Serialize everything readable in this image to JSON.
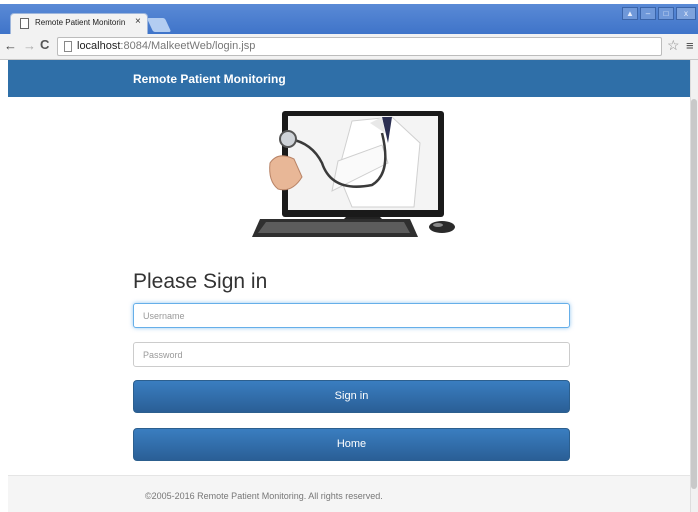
{
  "browser": {
    "tab_title": "Remote Patient Monitoring",
    "tab_close": "×",
    "url_host": "localhost",
    "url_path": ":8084/MalkeetWeb/login.jsp",
    "window_buttons": [
      "▲",
      "–",
      "□",
      "x"
    ],
    "nav_icons": {
      "back": "←",
      "forward": "→",
      "reload": "C",
      "star": "☆",
      "menu": "≡"
    }
  },
  "navbar": {
    "brand": "Remote Patient Monitoring"
  },
  "hero": {
    "image": "doctor-with-stethoscope-reaching-out-of-computer-monitor"
  },
  "form": {
    "heading": "Please Sign in",
    "username_placeholder": "Username",
    "username_value": "",
    "password_placeholder": "Password",
    "password_value": "",
    "signin_label": "Sign in",
    "home_label": "Home"
  },
  "footer": {
    "text": "©2005-2016 Remote Patient Monitoring. All rights reserved."
  },
  "colors": {
    "navbar": "#2f6fa8",
    "button": "#2f6fa8",
    "tab_strip": "#4a7fd0"
  }
}
